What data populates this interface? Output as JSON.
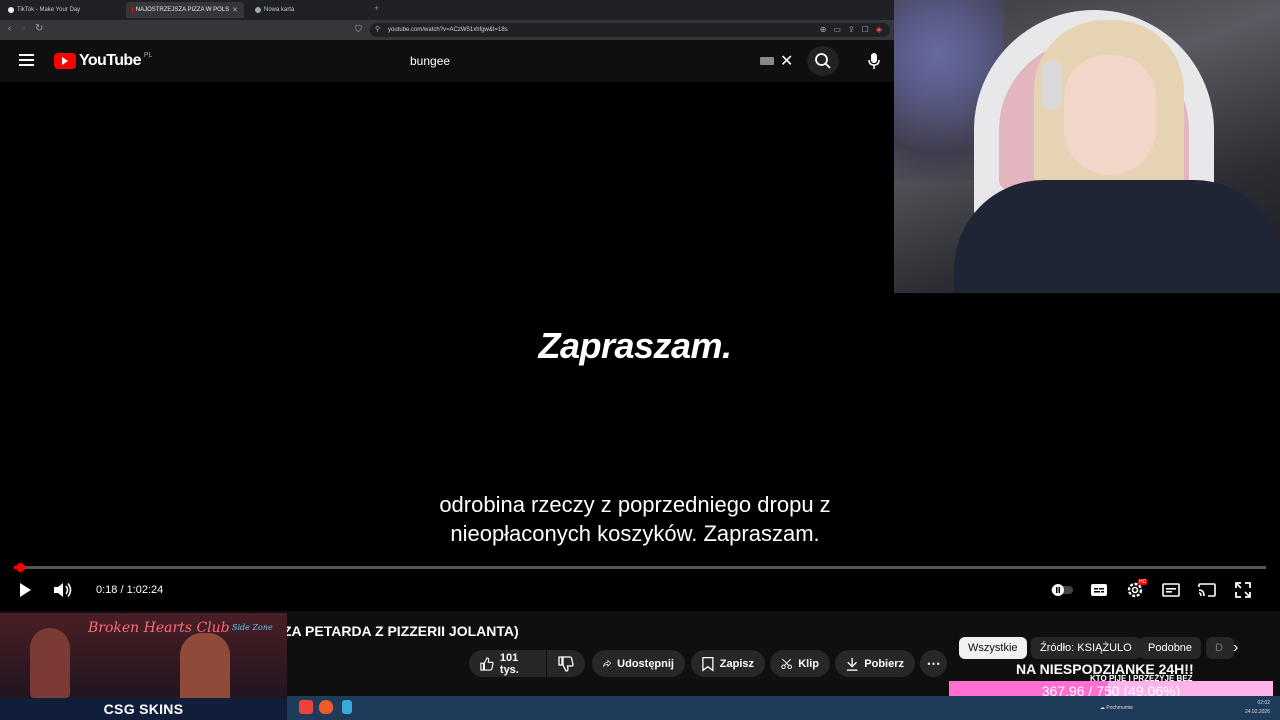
{
  "browser": {
    "tabs": [
      {
        "label": "TikTok - Make Your Day",
        "active": false
      },
      {
        "label": "NAJOSTRZEJSZA PIZZA W POLS",
        "active": true
      },
      {
        "label": "Nowa karta",
        "active": false
      }
    ],
    "new_tab_symbol": "+",
    "url": "youtube.com/watch?v=ACzW51xhfgw&t=18s"
  },
  "youtube": {
    "logo_text": "YouTube",
    "region": "PL",
    "search_value": "bungee",
    "accent_color": "#ff0000"
  },
  "video": {
    "big_caption": "Zapraszam.",
    "subtitle_line1": "odrobina rzeczy z poprzedniego dropu z",
    "subtitle_line2": "nieopłaconych koszyków. Zapraszam.",
    "time_display": "0:18 / 1:02:24",
    "progress_fraction": 0.0048,
    "settings_badge": "HD",
    "title_visible": "ZA PETARDA Z PIZZERII JOLANTA)"
  },
  "actions": {
    "like_count": "101 tys.",
    "share_label": "Udostępnij",
    "save_label": "Zapisz",
    "clip_label": "Klip",
    "download_label": "Pobierz"
  },
  "chips": [
    {
      "label": "Wszystkie",
      "selected": true
    },
    {
      "label": "Źródło: KSIĄŻULO",
      "selected": false
    },
    {
      "label": "Podobne",
      "selected": false
    },
    {
      "label": "D",
      "selected": false
    }
  ],
  "overlays": {
    "ad_title": "Broken Hearts Club",
    "ad_brand": "CSG SKINS",
    "ad_neon": "Side Zone",
    "goal_text": "NA NIESPODZIANKE 24H!!",
    "goal_text_partial": "KTO PIJE I PRZEŻYJE BEZ",
    "goal_label": "367.96 / 750 (49.06%)",
    "goal_fraction": 0.4906
  },
  "taskbar": {
    "weather": "Pochmurnie",
    "time": "02:02",
    "date": "24.02.2026"
  }
}
